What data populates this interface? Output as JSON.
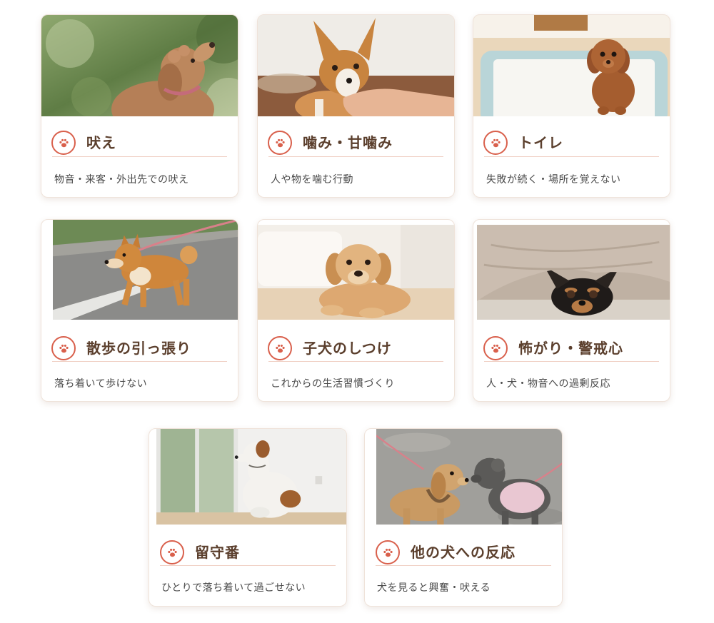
{
  "colors": {
    "accent": "#d9604c",
    "title": "#5b3f2d",
    "text": "#4a4a4a",
    "rule": "#f0d0c4",
    "card_border": "#efe3da"
  },
  "card_icon": "paw-icon",
  "cards": [
    {
      "title": "吠え",
      "desc": "物音・来客・外出先での吠え"
    },
    {
      "title": "噛み・甘噛み",
      "desc": "人や物を噛む行動"
    },
    {
      "title": "トイレ",
      "desc": "失敗が続く・場所を覚えない"
    },
    {
      "title": "散歩の引っ張り",
      "desc": "落ち着いて歩けない"
    },
    {
      "title": "子犬のしつけ",
      "desc": "これからの生活習慣づくり"
    },
    {
      "title": "怖がり・警戒心",
      "desc": "人・犬・物音への過剰反応"
    },
    {
      "title": "留守番",
      "desc": "ひとりで落ち着いて過ごせない"
    },
    {
      "title": "他の犬への反応",
      "desc": "犬を見ると興奮・吠える"
    }
  ]
}
